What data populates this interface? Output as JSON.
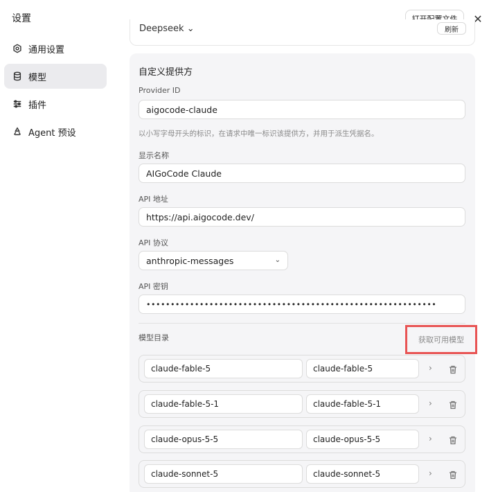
{
  "window": {
    "title": "设置",
    "open_config_label": "打开配置文件",
    "close_glyph": "✕"
  },
  "sidebar": {
    "items": [
      {
        "label": "通用设置",
        "icon": "gear-icon",
        "active": false
      },
      {
        "label": "模型",
        "icon": "database-icon",
        "active": true
      },
      {
        "label": "插件",
        "icon": "sliders-icon",
        "active": false
      },
      {
        "label": "Agent 预设",
        "icon": "recycle-icon",
        "active": false
      }
    ]
  },
  "top_card": {
    "name": "Deepseek ⌄",
    "button_label": "刷新"
  },
  "custom_provider": {
    "title": "自定义提供方",
    "provider_id": {
      "label": "Provider ID",
      "value": "aigocode-claude",
      "hint": "以小写字母开头的标识，在请求中唯一标识该提供方，并用于派生凭据名。"
    },
    "display_name": {
      "label": "显示名称",
      "value": "AIGoCode Claude"
    },
    "api_url": {
      "label": "API 地址",
      "value": "https://api.aigocode.dev/"
    },
    "api_protocol": {
      "label": "API 协议",
      "value": "anthropic-messages"
    },
    "api_key": {
      "label": "API 密钥",
      "value": "••••••••••••••••••••••••••••••••••••••••••••••••••••••••••••"
    },
    "catalog": {
      "label": "模型目录",
      "fetch_label": "获取可用模型",
      "rows": [
        {
          "id": "claude-fable-5",
          "name": "claude-fable-5"
        },
        {
          "id": "claude-fable-5-1",
          "name": "claude-fable-5-1"
        },
        {
          "id": "claude-opus-5-5",
          "name": "claude-opus-5-5"
        },
        {
          "id": "claude-sonnet-5",
          "name": "claude-sonnet-5"
        }
      ]
    }
  },
  "colors": {
    "highlight_border": "#e85353",
    "panel_bg": "#f5f5f7",
    "active_nav_bg": "#ebebee"
  }
}
